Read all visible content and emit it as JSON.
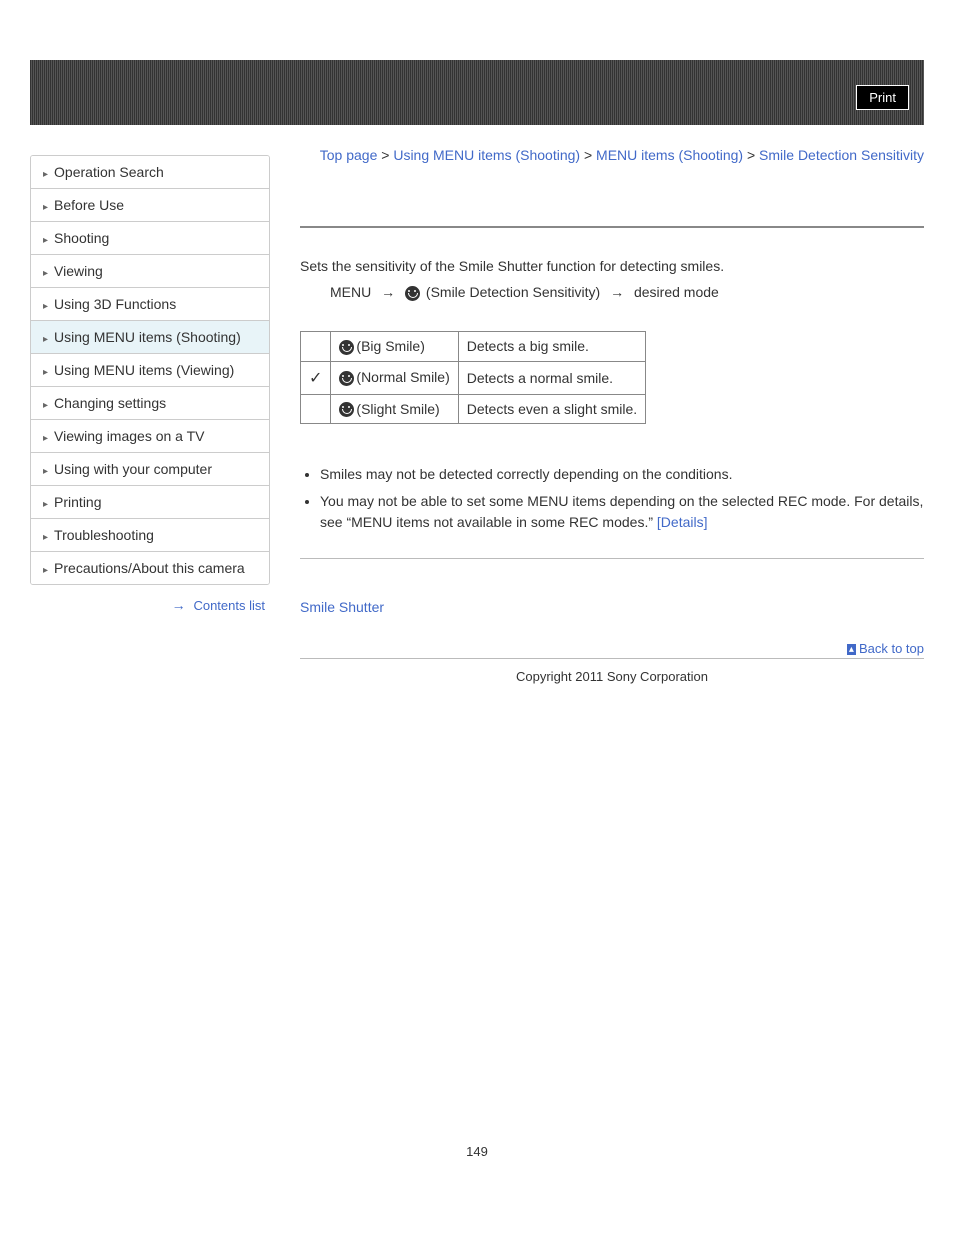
{
  "print_button": "Print",
  "sidebar": {
    "items": [
      {
        "label": "Operation Search"
      },
      {
        "label": "Before Use"
      },
      {
        "label": "Shooting"
      },
      {
        "label": "Viewing"
      },
      {
        "label": "Using 3D Functions"
      },
      {
        "label": "Using MENU items (Shooting)"
      },
      {
        "label": "Using MENU items (Viewing)"
      },
      {
        "label": "Changing settings"
      },
      {
        "label": "Viewing images on a TV"
      },
      {
        "label": "Using with your computer"
      },
      {
        "label": "Printing"
      },
      {
        "label": "Troubleshooting"
      },
      {
        "label": "Precautions/About this camera"
      }
    ],
    "contents_link": "Contents list"
  },
  "breadcrumb": {
    "items": [
      "Top page",
      "Using MENU items (Shooting)",
      "MENU items (Shooting)"
    ],
    "current": "Smile Detection Sensitivity",
    "sep": ">"
  },
  "intro": "Sets the sensitivity of the Smile Shutter function for detecting smiles.",
  "menu_path": {
    "prefix": "MENU",
    "middle": "(Smile Detection Sensitivity)",
    "suffix": "desired mode"
  },
  "table_rows": [
    {
      "check": "",
      "label": "(Big Smile)",
      "desc": "Detects a big smile."
    },
    {
      "check": "✓",
      "label": "(Normal Smile)",
      "desc": "Detects a normal smile."
    },
    {
      "check": "",
      "label": "(Slight Smile)",
      "desc": "Detects even a slight smile."
    }
  ],
  "notes": [
    {
      "text": "Smiles may not be detected correctly depending on the conditions.",
      "link": ""
    },
    {
      "text": "You may not be able to set some MENU items depending on the selected REC mode. For details, see “MENU items not available in some REC modes.” ",
      "link": "[Details]"
    }
  ],
  "related_link": "Smile Shutter",
  "back_to_top": "Back to top",
  "copyright": "Copyright 2011 Sony Corporation",
  "page_number": "149"
}
